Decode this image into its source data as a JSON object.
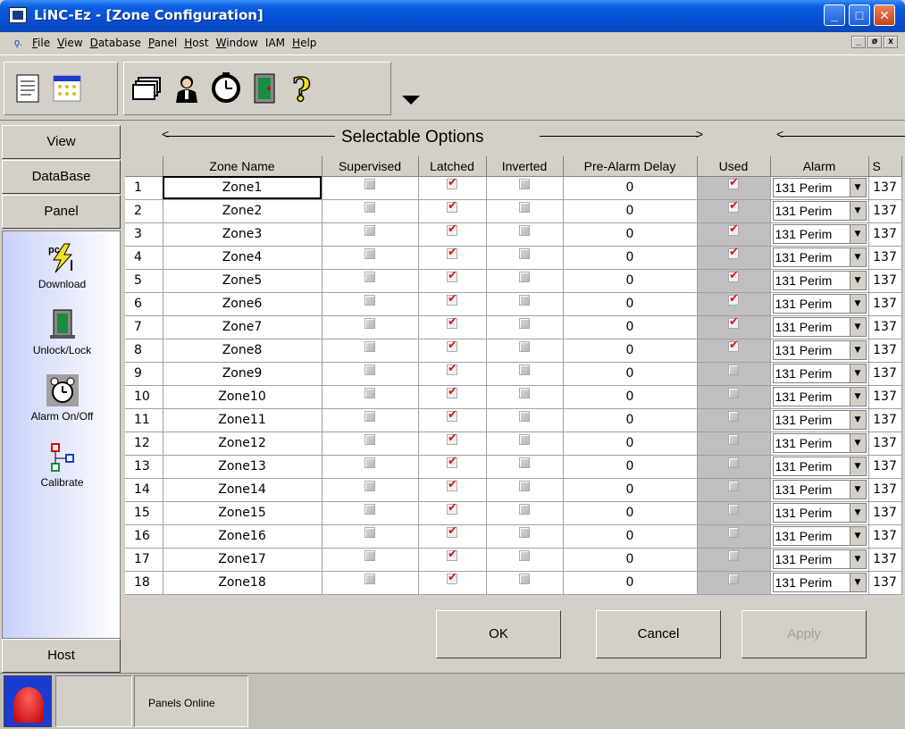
{
  "window": {
    "title": "LiNC-Ez - [Zone Configuration]"
  },
  "menu": {
    "items": [
      {
        "label": "File",
        "u": "F"
      },
      {
        "label": "View",
        "u": "V"
      },
      {
        "label": "Database",
        "u": "D"
      },
      {
        "label": "Panel",
        "u": "P"
      },
      {
        "label": "Host",
        "u": "H"
      },
      {
        "label": "Window",
        "u": "W"
      },
      {
        "label": "IAM",
        "u": ""
      },
      {
        "label": "Help",
        "u": "H"
      }
    ]
  },
  "nav": {
    "view": "View",
    "database": "DataBase",
    "panel": "Panel",
    "host": "Host",
    "items": [
      "Download",
      "Unlock/Lock",
      "Alarm On/Off",
      "Calibrate"
    ]
  },
  "grid": {
    "group_label": "Selectable Options",
    "columns": [
      "Zone Name",
      "Supervised",
      "Latched",
      "Inverted",
      "Pre-Alarm Delay",
      "Used",
      "Alarm",
      "S"
    ],
    "rows": [
      {
        "n": "1",
        "name": "Zone1",
        "sup": false,
        "lat": true,
        "inv": false,
        "delay": "0",
        "used": true,
        "alarm": "131 Perim",
        "s": "137"
      },
      {
        "n": "2",
        "name": "Zone2",
        "sup": false,
        "lat": true,
        "inv": false,
        "delay": "0",
        "used": true,
        "alarm": "131 Perim",
        "s": "137"
      },
      {
        "n": "3",
        "name": "Zone3",
        "sup": false,
        "lat": true,
        "inv": false,
        "delay": "0",
        "used": true,
        "alarm": "131 Perim",
        "s": "137"
      },
      {
        "n": "4",
        "name": "Zone4",
        "sup": false,
        "lat": true,
        "inv": false,
        "delay": "0",
        "used": true,
        "alarm": "131 Perim",
        "s": "137"
      },
      {
        "n": "5",
        "name": "Zone5",
        "sup": false,
        "lat": true,
        "inv": false,
        "delay": "0",
        "used": true,
        "alarm": "131 Perim",
        "s": "137"
      },
      {
        "n": "6",
        "name": "Zone6",
        "sup": false,
        "lat": true,
        "inv": false,
        "delay": "0",
        "used": true,
        "alarm": "131 Perim",
        "s": "137"
      },
      {
        "n": "7",
        "name": "Zone7",
        "sup": false,
        "lat": true,
        "inv": false,
        "delay": "0",
        "used": true,
        "alarm": "131 Perim",
        "s": "137"
      },
      {
        "n": "8",
        "name": "Zone8",
        "sup": false,
        "lat": true,
        "inv": false,
        "delay": "0",
        "used": true,
        "alarm": "131 Perim",
        "s": "137"
      },
      {
        "n": "9",
        "name": "Zone9",
        "sup": false,
        "lat": true,
        "inv": false,
        "delay": "0",
        "used": false,
        "alarm": "131 Perim",
        "s": "137"
      },
      {
        "n": "10",
        "name": "Zone10",
        "sup": false,
        "lat": true,
        "inv": false,
        "delay": "0",
        "used": false,
        "alarm": "131 Perim",
        "s": "137"
      },
      {
        "n": "11",
        "name": "Zone11",
        "sup": false,
        "lat": true,
        "inv": false,
        "delay": "0",
        "used": false,
        "alarm": "131 Perim",
        "s": "137"
      },
      {
        "n": "12",
        "name": "Zone12",
        "sup": false,
        "lat": true,
        "inv": false,
        "delay": "0",
        "used": false,
        "alarm": "131 Perim",
        "s": "137"
      },
      {
        "n": "13",
        "name": "Zone13",
        "sup": false,
        "lat": true,
        "inv": false,
        "delay": "0",
        "used": false,
        "alarm": "131 Perim",
        "s": "137"
      },
      {
        "n": "14",
        "name": "Zone14",
        "sup": false,
        "lat": true,
        "inv": false,
        "delay": "0",
        "used": false,
        "alarm": "131 Perim",
        "s": "137"
      },
      {
        "n": "15",
        "name": "Zone15",
        "sup": false,
        "lat": true,
        "inv": false,
        "delay": "0",
        "used": false,
        "alarm": "131 Perim",
        "s": "137"
      },
      {
        "n": "16",
        "name": "Zone16",
        "sup": false,
        "lat": true,
        "inv": false,
        "delay": "0",
        "used": false,
        "alarm": "131 Perim",
        "s": "137"
      },
      {
        "n": "17",
        "name": "Zone17",
        "sup": false,
        "lat": true,
        "inv": false,
        "delay": "0",
        "used": false,
        "alarm": "131 Perim",
        "s": "137"
      },
      {
        "n": "18",
        "name": "Zone18",
        "sup": false,
        "lat": true,
        "inv": false,
        "delay": "0",
        "used": false,
        "alarm": "131 Perim",
        "s": "137"
      }
    ]
  },
  "buttons": {
    "ok": "OK",
    "cancel": "Cancel",
    "apply": "Apply"
  },
  "status": {
    "panels": "Panels Online"
  },
  "colors": {
    "title_bar": "#0550d4",
    "check_mark": "#d81818",
    "nav_panel": "#c8d0f8"
  }
}
